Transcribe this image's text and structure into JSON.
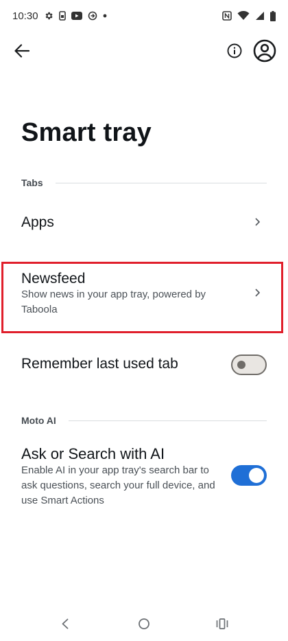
{
  "status_bar": {
    "time": "10:30",
    "left_icons": [
      "gear-icon",
      "sim-icon",
      "youtube-icon",
      "sync-icon",
      "dot-icon"
    ],
    "right_icons": [
      "nfc-icon",
      "wifi-icon",
      "signal-icon",
      "battery-icon"
    ]
  },
  "app_bar": {
    "back_icon": "arrow-left-icon",
    "info_icon": "info-icon",
    "account_icon": "account-circle-icon"
  },
  "page": {
    "title": "Smart tray"
  },
  "sections": {
    "tabs": "Tabs",
    "moto_ai": "Moto AI"
  },
  "rows": {
    "apps": {
      "title": "Apps"
    },
    "newsfeed": {
      "title": "Newsfeed",
      "subtitle": "Show news in your app tray, powered by Taboola"
    },
    "remember_tab": {
      "title": "Remember last used tab",
      "enabled": false
    },
    "ask_ai": {
      "title": "Ask or Search with AI",
      "subtitle": "Enable AI in your app tray's search bar to ask questions, search your full device, and use Smart Actions",
      "enabled": true
    }
  },
  "colors": {
    "accent": "#1f6fd6",
    "highlight": "#e01f2b",
    "text_primary": "#101418",
    "text_secondary": "#4a5056"
  },
  "nav_bar": {
    "icons": [
      "back-triangle-icon",
      "home-circle-icon",
      "recents-icon"
    ]
  }
}
